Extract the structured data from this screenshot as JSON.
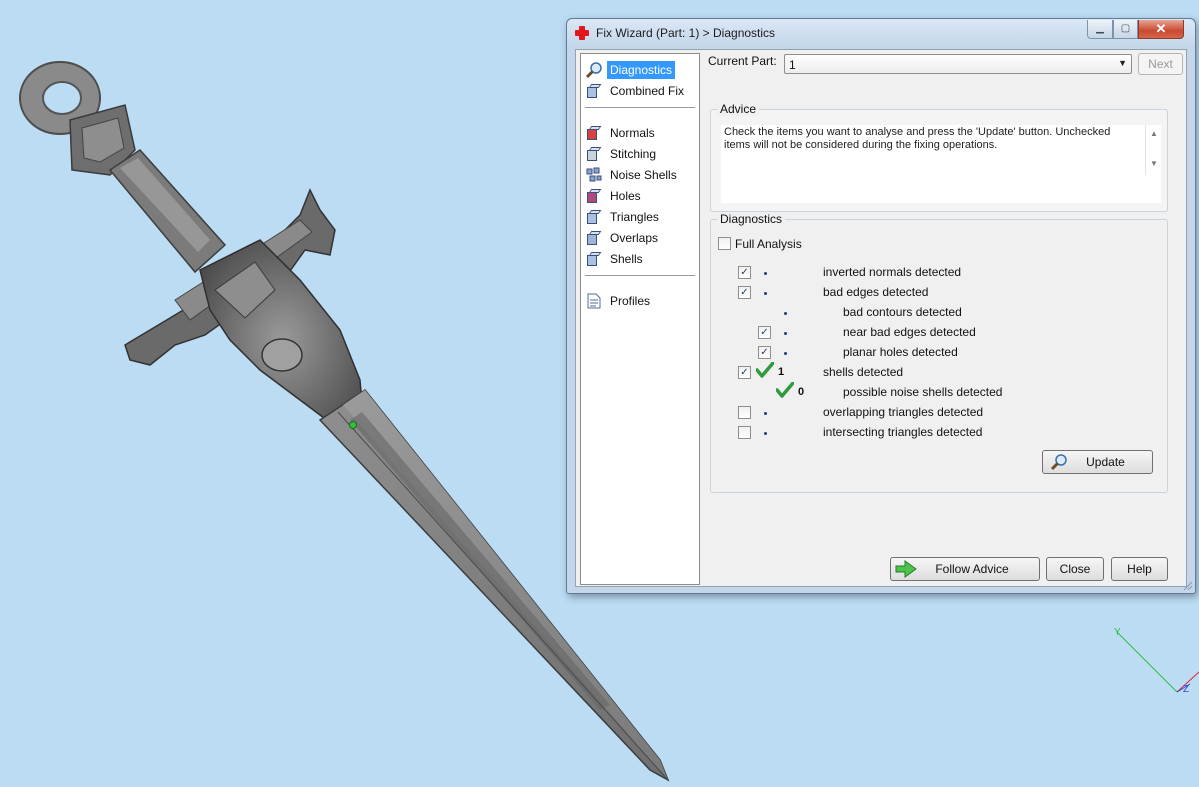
{
  "window": {
    "title": "Fix Wizard (Part: 1) > Diagnostics",
    "controls": {
      "minimize": "▁",
      "maximize": "▢",
      "close": "✕"
    }
  },
  "nav": {
    "items": [
      {
        "label": "Diagnostics",
        "icon": "magnifier-icon",
        "active": true
      },
      {
        "label": "Combined Fix",
        "icon": "cube-icon",
        "active": false
      },
      {
        "label": "Normals",
        "icon": "normals-cube-icon",
        "active": false
      },
      {
        "label": "Stitching",
        "icon": "stitching-cube-icon",
        "active": false
      },
      {
        "label": "Noise Shells",
        "icon": "noise-shells-icon",
        "active": false
      },
      {
        "label": "Holes",
        "icon": "holes-cube-icon",
        "active": false
      },
      {
        "label": "Triangles",
        "icon": "triangles-cube-icon",
        "active": false
      },
      {
        "label": "Overlaps",
        "icon": "overlaps-cube-icon",
        "active": false
      },
      {
        "label": "Shells",
        "icon": "shells-cube-icon",
        "active": false
      },
      {
        "label": "Profiles",
        "icon": "document-icon",
        "active": false
      }
    ]
  },
  "current_part": {
    "label": "Current Part:",
    "value": "1"
  },
  "next_button": "Next",
  "advice": {
    "title": "Advice",
    "text": "Check the items you want to analyse and press the 'Update' button. Unchecked items will not be considered during the fixing operations."
  },
  "diagnostics": {
    "title": "Diagnostics",
    "full_analysis": {
      "label": "Full Analysis",
      "checked": false
    },
    "rows": [
      {
        "label": "inverted normals detected",
        "checked": true,
        "count": "",
        "ok": false
      },
      {
        "label": "bad edges detected",
        "checked": true,
        "count": "",
        "ok": false
      },
      {
        "label": "bad contours detected",
        "checked": null,
        "count": "",
        "ok": false
      },
      {
        "label": "near bad edges detected",
        "checked": true,
        "count": "",
        "ok": false
      },
      {
        "label": "planar holes detected",
        "checked": true,
        "count": "",
        "ok": false
      },
      {
        "label": "shells detected",
        "checked": true,
        "count": "1",
        "ok": true
      },
      {
        "label": "possible noise shells detected",
        "checked": null,
        "count": "0",
        "ok": true
      },
      {
        "label": "overlapping triangles detected",
        "checked": false,
        "count": "",
        "ok": false
      },
      {
        "label": "intersecting triangles detected",
        "checked": false,
        "count": "",
        "ok": false
      }
    ],
    "update_button": "Update"
  },
  "footer": {
    "follow_advice": "Follow Advice",
    "close": "Close",
    "help": "Help"
  },
  "axes": {
    "y": "Y",
    "z": "Z"
  },
  "colors": {
    "viewport_bg": "#bcdcf4",
    "selection": "#3399ff",
    "check_green": "#2f9a3e",
    "title_close": "#c84a31"
  }
}
